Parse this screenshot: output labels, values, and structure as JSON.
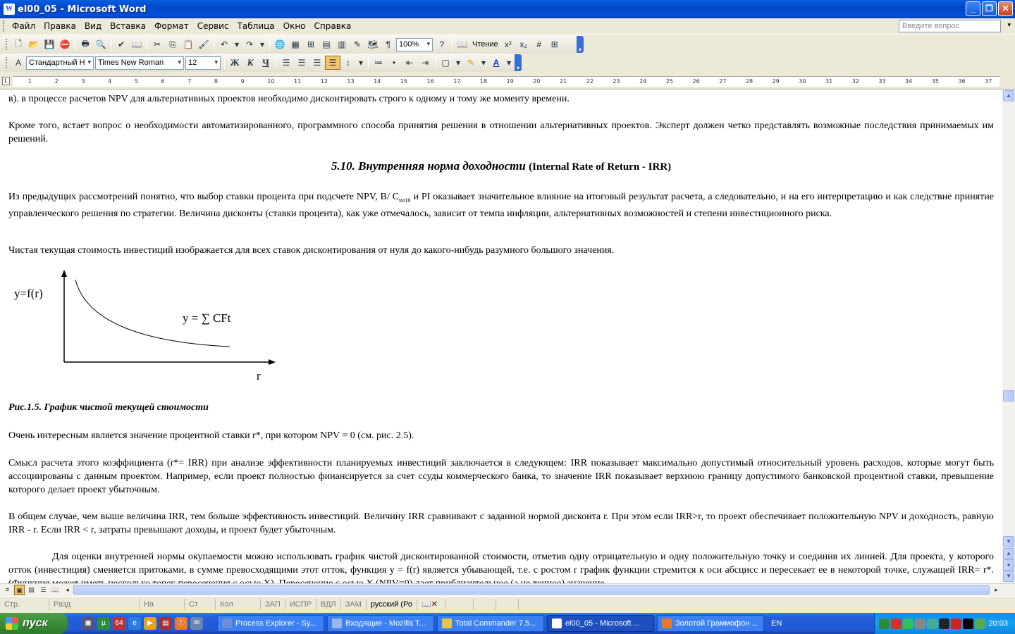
{
  "window": {
    "title": "el00_05 - Microsoft Word",
    "app_icon": "W",
    "buttons": {
      "minimize": "_",
      "maximize": "❐",
      "close": "✕"
    }
  },
  "menu": {
    "items": [
      "Файл",
      "Правка",
      "Вид",
      "Вставка",
      "Формат",
      "Сервис",
      "Таблица",
      "Окно",
      "Справка"
    ],
    "ask_placeholder": "Введите вопрос"
  },
  "toolbar_standard": {
    "zoom": "100%",
    "reading_label": "Чтение"
  },
  "toolbar_format": {
    "style": "Стандартный Н",
    "font": "Times New Roman",
    "size": "12",
    "bold": "Ж",
    "italic": "К",
    "underline": "Ч"
  },
  "ruler": {
    "ticks": [
      "1",
      "2",
      "3",
      "4",
      "5",
      "6",
      "7",
      "8",
      "9",
      "10",
      "11",
      "12",
      "13",
      "14",
      "15",
      "16",
      "17",
      "18",
      "19",
      "20",
      "21",
      "22",
      "23",
      "24",
      "25",
      "26",
      "27",
      "28",
      "29",
      "30",
      "31",
      "32",
      "33",
      "34",
      "35",
      "36",
      "37"
    ]
  },
  "document": {
    "p1": "в).  в процессе расчетов NPV для альтернативных проектов необходимо дисконтировать строго к одному и тому же моменту времени.",
    "p2": "Кроме того, встает вопрос о необходимости автоматизированного, программного способа принятия решения в отношении альтернативных проектов. Эксперт должен четко представлять возможные последствия принимаемых им решений.",
    "heading_main": "5.10. Внутренняя норма доходности",
    "heading_sub": "(Internal Rate of Return - IRR)",
    "p3": "Из предыдущих рассмотрений понятно, что выбор ставки процента при подсчете NPV, B/ C",
    "p3_sub": "tot10",
    "p3_rest": " и PI оказывает значительное влияние на итоговый результат расчета, а следовательно, и на его интерпретацию и как следствие принятие управленческого решения по стратегии. Величина дисконты (ставки процента), как уже отмечалось, зависит от темпа инфляции, альтернативных возможностей и степени инвестиционного риска.",
    "p4": "Чистая текущая стоимость инвестиций изображается для всех ставок дисконтирования от нуля до какого-нибудь разумного большого значения.",
    "graph_ylabel": "y=f(r)",
    "graph_formula": "y = ∑ CFt",
    "graph_xlabel": "r",
    "caption": "Рис.1.5. График чистой текущей стоимости",
    "p5": "Очень интересным является значение процентной ставки r*,    при котором NPV = 0 (см. рис. 2.5).",
    "p6": "Смысл расчета этого коэффициента (r*= IRR) при анализе эффективности планируемых инвестиций заключается в следующем: IRR показывает максимально допустимый относительный уровень расходов, которые могут быть ассоциированы с данным проектом. Например, если проект полностью финансируется за счет ссуды коммерческого банка, то значение IRR показывает верхнюю границу допустимого банковской процентной ставки, превышение которого делает проект убыточным.",
    "p7": "В общем случае, чем выше величина IRR, тем больше эффективность инвестиций. Величину IRR сравнивают с заданной нормой дисконта r. При этом если IRR>r, то проект обеспечивает положительную NPV и доходность, равную IRR - r. Если IRR < r, затраты превышают доходы, и проект будет убыточным.",
    "p8": "Для оценки внутренней нормы окупаемости можно использовать график чистой дисконтированной стоимости, отметив одну отрицательную и одну положительную точку и соединив их линией. Для проекта, у которого отток (инвестиция) сменяется притоками, в сумме превосходящими этот отток, функция y = f(r) является убывающей, т.е. с ростом r график функции стремится к оси абсцисс и пересекает ее в некоторой точке, служащей IRR= r*. (Функция может иметь несколько точек пересечения с осью Х). Пересечение с осью Х (NPV=0) дает приблизительное (а не точное) значение"
  },
  "statusbar": {
    "page": "Стр.",
    "section": "Разд",
    "at": "На",
    "line": "Ст",
    "col": "Кол",
    "rec": "ЗАП",
    "trk": "ИСПР",
    "ext": "ВДЛ",
    "ovr": "ЗАМ",
    "language": "русский (Ро"
  },
  "taskbar": {
    "start": "пуск",
    "tasks": [
      {
        "label": "Process Explorer - Sy...",
        "color": "#6a8fd8"
      },
      {
        "label": "Входящие - Mozilla T...",
        "color": "#9bb6e8"
      },
      {
        "label": "Total Commander 7.5...",
        "color": "#e6c34a"
      },
      {
        "label": "el00_05 - Microsoft ...",
        "color": "#2b5fd0"
      },
      {
        "label": "Золотой Граммофон ...",
        "color": "#e8782a"
      }
    ],
    "language": "EN",
    "clock": "20:03"
  }
}
